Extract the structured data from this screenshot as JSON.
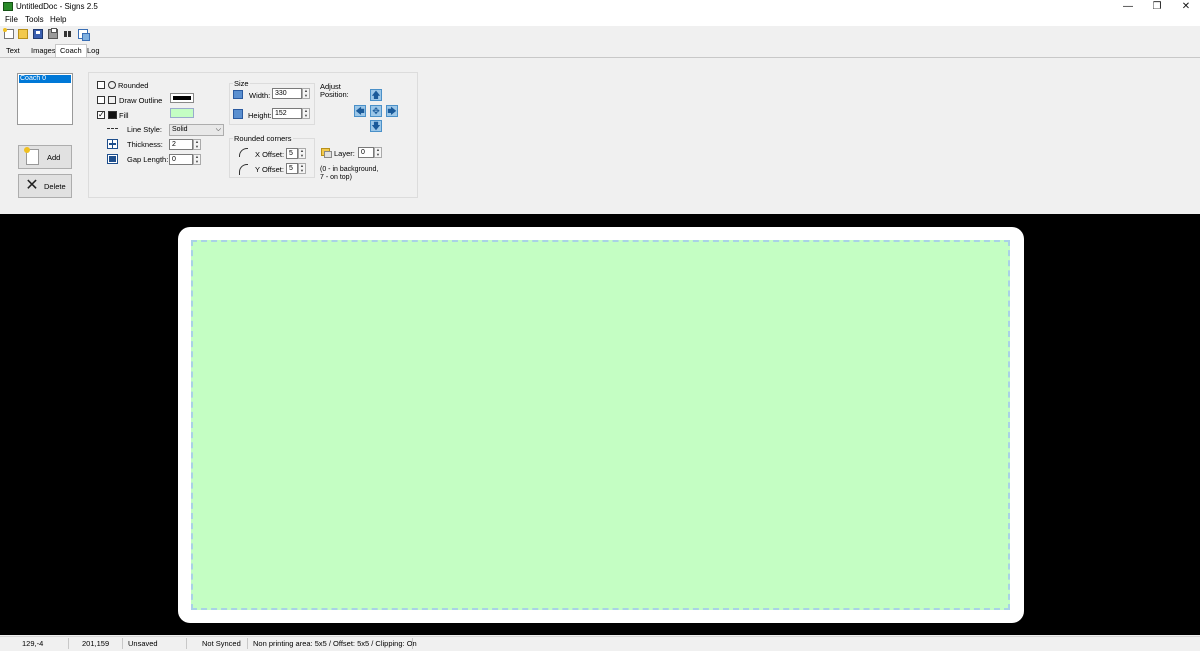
{
  "window": {
    "title": "UntitledDoc - Signs 2.5",
    "minimize_glyph": "—",
    "restore_glyph": "❐",
    "close_glyph": "✕"
  },
  "menu": [
    "File",
    "Tools",
    "Help"
  ],
  "toolbar": {
    "icons": [
      "new-icon",
      "open-icon",
      "save-icon",
      "print-icon",
      "find-icon",
      "copy-icon"
    ]
  },
  "tabs": [
    {
      "label": "Text",
      "active": false
    },
    {
      "label": "Images",
      "active": false
    },
    {
      "label": "Coach",
      "active": true
    },
    {
      "label": "Log",
      "active": false
    }
  ],
  "shape_list": {
    "items": [
      "Coach 0"
    ]
  },
  "buttons": {
    "add": "Add",
    "delete": "Delete"
  },
  "props": {
    "rounded_label": "Rounded",
    "rounded_checked": false,
    "draw_outline_label": "Draw Outline",
    "draw_outline_checked": false,
    "outline_color": "#000000",
    "fill_label": "Fill",
    "fill_checked": true,
    "fill_color": "#c4fec3",
    "line_style_label": "Line Style:",
    "line_style_value": "Solid",
    "thickness_label": "Thickness:",
    "thickness_value": "2",
    "gap_length_label": "Gap Length:",
    "gap_length_value": "0"
  },
  "size": {
    "title": "Size",
    "width_label": "Width:",
    "width_value": "330",
    "height_label": "Height:",
    "height_value": "152"
  },
  "rounded_corners": {
    "title": "Rounded corners",
    "x_label": "X Offset:",
    "x_value": "5",
    "y_label": "Y Offset:",
    "y_value": "5"
  },
  "adjust": {
    "title_line1": "Adjust",
    "title_line2": "Position:",
    "up": "🡅",
    "down": "🡇",
    "left": "🡄",
    "right": "🡆",
    "center": "✥"
  },
  "layer": {
    "label": "Layer:",
    "value": "0",
    "hint_line1": "(0 - in background,",
    "hint_line2": "7 - on top)"
  },
  "canvas": {
    "background": "#000000",
    "card_color": "#ffffff",
    "fill_color": "#c4fec3",
    "dash_color": "#a9d2e6"
  },
  "status": {
    "cursor": "129,-4",
    "coords": "201,159",
    "saved": "Unsaved",
    "sync": "Not Synced",
    "info": "Non printing area: 5x5 / Offset: 5x5 / Clipping: On"
  }
}
